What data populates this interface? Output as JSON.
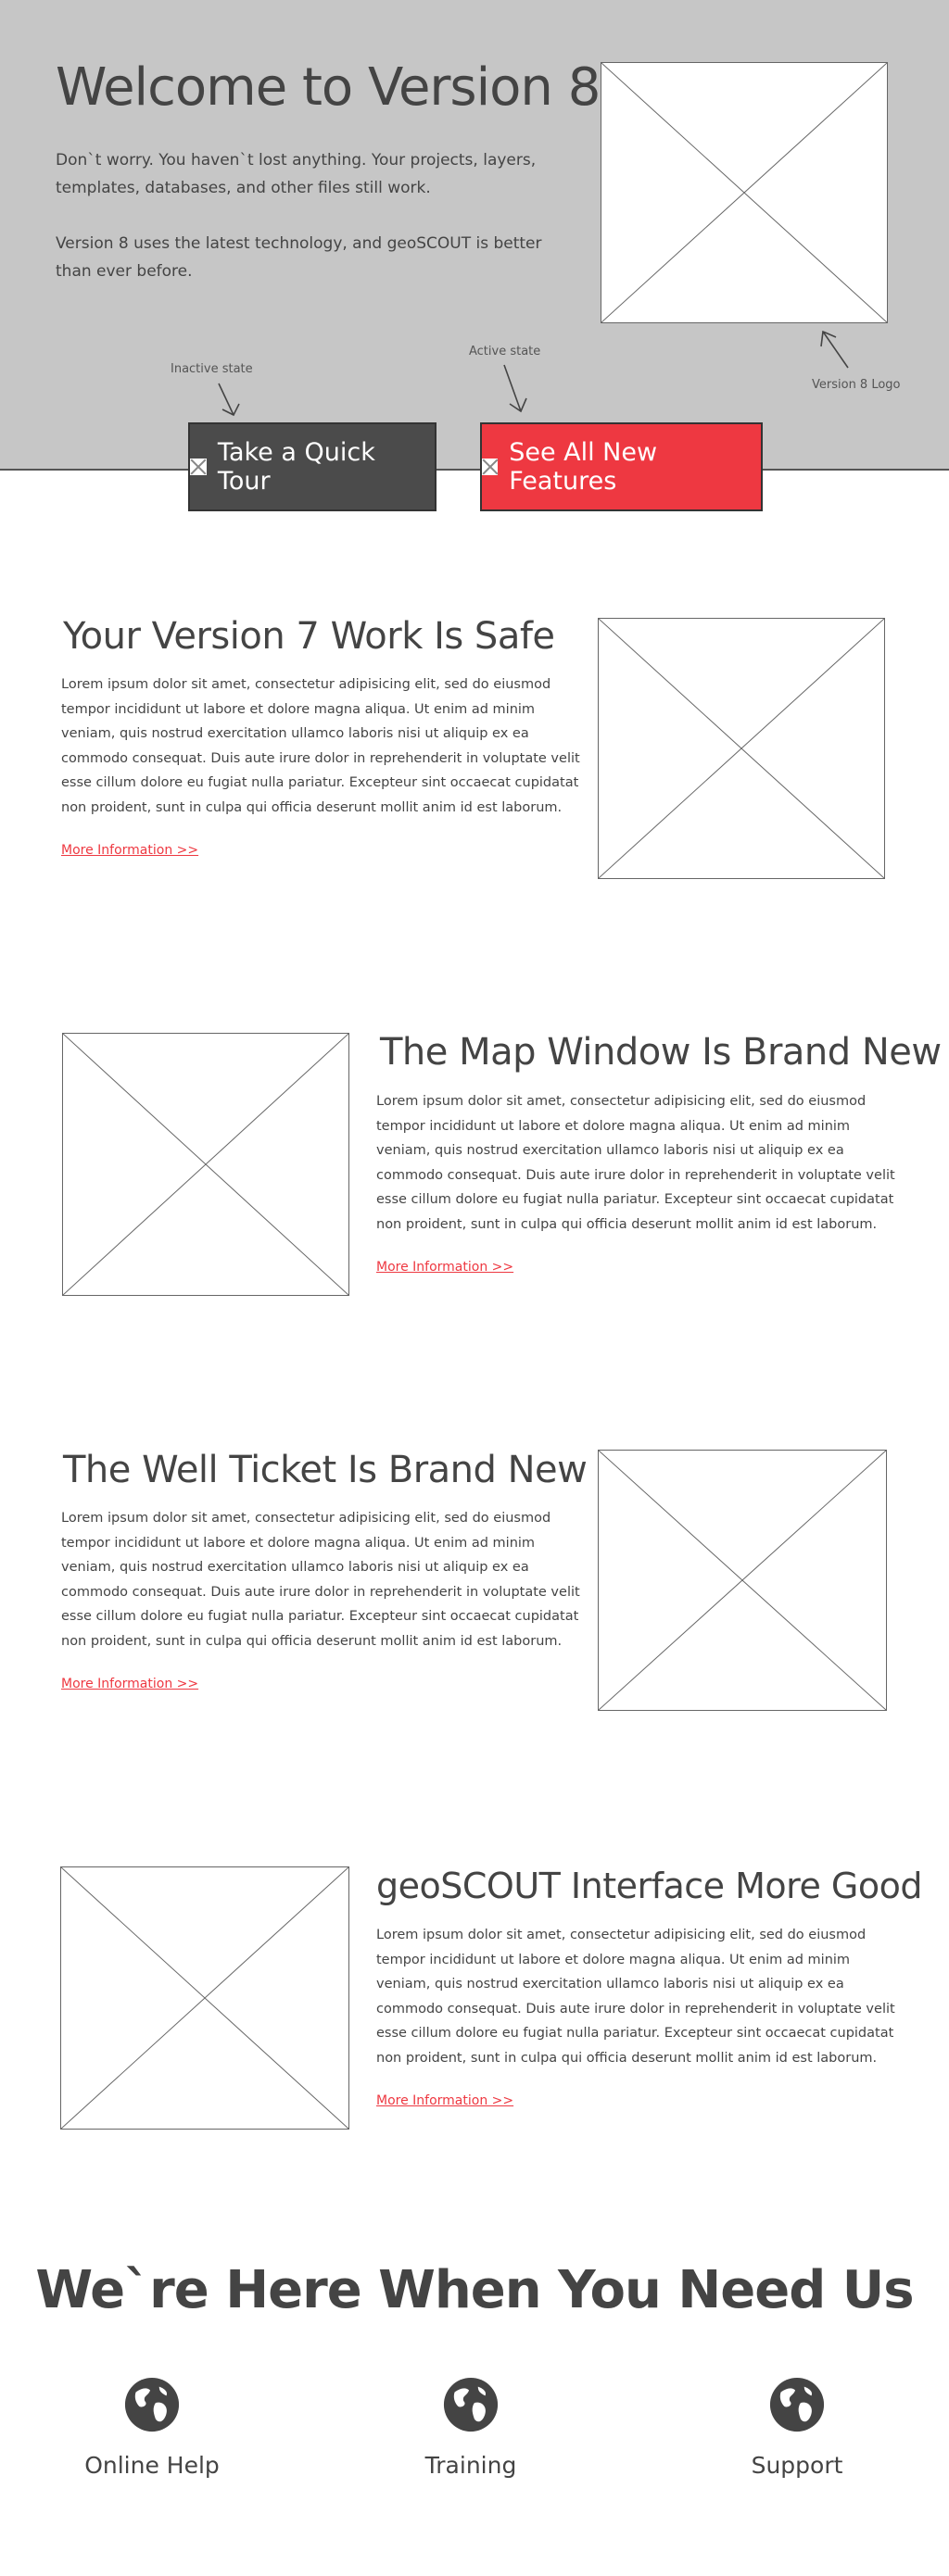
{
  "hero": {
    "title": "Welcome to Version 8",
    "paragraph1": "Don`t worry. You haven`t lost anything. Your projects, layers, templates, databases, and other files still work.",
    "paragraph2": "Version 8 uses the latest technology, and geoSCOUT is better than ever before.",
    "logo_annotation": "Version 8 Logo",
    "inactive_annotation": "Inactive state",
    "active_annotation": "Active state"
  },
  "buttons": {
    "tour_label": "Take a Quick Tour",
    "features_label": "See All New Features"
  },
  "sections": [
    {
      "title": "Your Version 7 Work Is Safe",
      "body": "Lorem ipsum dolor sit amet, consectetur adipisicing elit, sed do eiusmod tempor incididunt ut labore et dolore magna aliqua. Ut enim ad minim veniam, quis nostrud exercitation ullamco laboris nisi ut aliquip ex ea commodo consequat. Duis aute irure dolor in reprehenderit in voluptate velit esse cillum dolore eu fugiat nulla pariatur. Excepteur sint occaecat cupidatat non proident, sunt in culpa qui officia deserunt mollit anim id est laborum.",
      "link": "More Information >>"
    },
    {
      "title": "The Map Window Is Brand New",
      "body": "Lorem ipsum dolor sit amet, consectetur adipisicing elit, sed do eiusmod tempor incididunt ut labore et dolore magna aliqua. Ut enim ad minim veniam, quis nostrud exercitation ullamco laboris nisi ut aliquip ex ea commodo consequat. Duis aute irure dolor in reprehenderit in voluptate velit esse cillum dolore eu fugiat nulla pariatur. Excepteur sint occaecat cupidatat non proident, sunt in culpa qui officia deserunt mollit anim id est laborum.",
      "link": "More Information >>"
    },
    {
      "title": "The Well Ticket Is Brand New",
      "body": "Lorem ipsum dolor sit amet, consectetur adipisicing elit, sed do eiusmod tempor incididunt ut labore et dolore magna aliqua. Ut enim ad minim veniam, quis nostrud exercitation ullamco laboris nisi ut aliquip ex ea commodo consequat. Duis aute irure dolor in reprehenderit in voluptate velit esse cillum dolore eu fugiat nulla pariatur. Excepteur sint occaecat cupidatat non proident, sunt in culpa qui officia deserunt mollit anim id est laborum.",
      "link": "More Information >>"
    },
    {
      "title": "geoSCOUT Interface More Good",
      "body": "Lorem ipsum dolor sit amet, consectetur adipisicing elit, sed do eiusmod tempor incididunt ut labore et dolore magna aliqua. Ut enim ad minim veniam, quis nostrud exercitation ullamco laboris nisi ut aliquip ex ea commodo consequat. Duis aute irure dolor in reprehenderit in voluptate velit esse cillum dolore eu fugiat nulla pariatur. Excepteur sint occaecat cupidatat non proident, sunt in culpa qui officia deserunt mollit anim id est laborum.",
      "link": "More Information >>"
    }
  ],
  "help": {
    "title": "We`re Here When You Need Us",
    "items": [
      {
        "label": "Online Help",
        "icon": "globe-icon"
      },
      {
        "label": "Training",
        "icon": "globe-icon"
      },
      {
        "label": "Support",
        "icon": "globe-icon"
      }
    ]
  },
  "colors": {
    "hero_bg": "#c6c6c6",
    "accent": "#ee3841",
    "button_inactive": "#4b4b4b",
    "text": "#444444"
  }
}
